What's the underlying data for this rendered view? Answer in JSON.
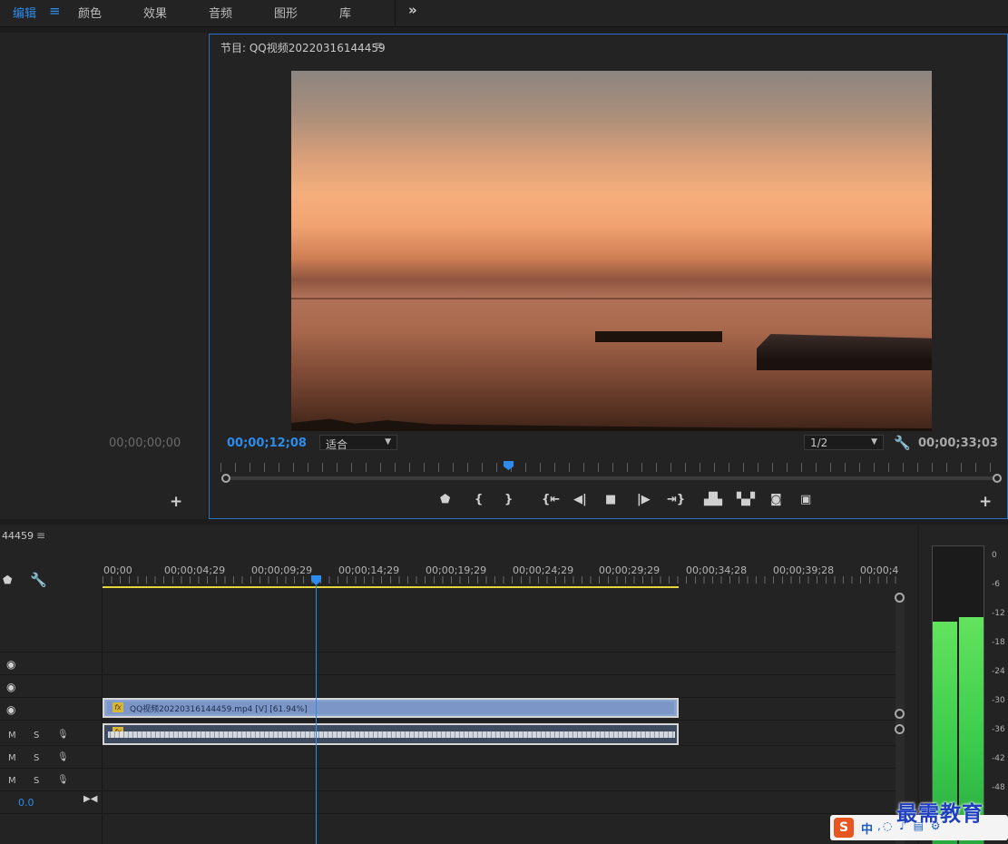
{
  "workspace": {
    "tabs": [
      "编辑",
      "颜色",
      "效果",
      "音频",
      "图形",
      "库"
    ],
    "active_tab": "编辑",
    "menu_icon": "hamburger-icon",
    "more_icon": "chevron-double-right-icon"
  },
  "source_panel": {
    "timecode": "00;00;00;00",
    "add_icon": "plus-icon"
  },
  "program_monitor": {
    "title": "节目: QQ视频20220316144459",
    "current_timecode": "00;00;12;08",
    "fit_option": "适合",
    "resolution": "1/2",
    "duration": "00;00;33;03",
    "playhead_fraction": 0.37,
    "transport": [
      "marker-icon",
      "mark-in-icon",
      "mark-out-icon",
      "go-to-in-icon",
      "step-back-icon",
      "stop-icon",
      "step-forward-icon",
      "go-to-out-icon",
      "lift-icon",
      "extract-icon",
      "export-frame-icon",
      "compare-icon"
    ]
  },
  "timeline": {
    "title": "44459",
    "ruler": [
      "00;00",
      "00;00;04;29",
      "00;00;09;29",
      "00;00;14;29",
      "00;00;19;29",
      "00;00;24;29",
      "00;00;29;29",
      "00;00;34;28",
      "00;00;39;28",
      "00;00;4"
    ],
    "video_clip_label": "QQ视频20220316144459.mp4 [V] [61.94%]",
    "fx_label": "fx",
    "audio_track_buttons": [
      "M",
      "S"
    ],
    "volume": "0.0"
  },
  "audio_meter": {
    "scale": [
      "0",
      "-6",
      "-12",
      "-18",
      "-24",
      "-30",
      "-36",
      "-42",
      "-48"
    ],
    "left_level_db": -12.5,
    "right_level_db": -12.0
  },
  "overlays": {
    "ime_logo": "S",
    "ime_lang": "中",
    "watermark": "最需教育"
  }
}
